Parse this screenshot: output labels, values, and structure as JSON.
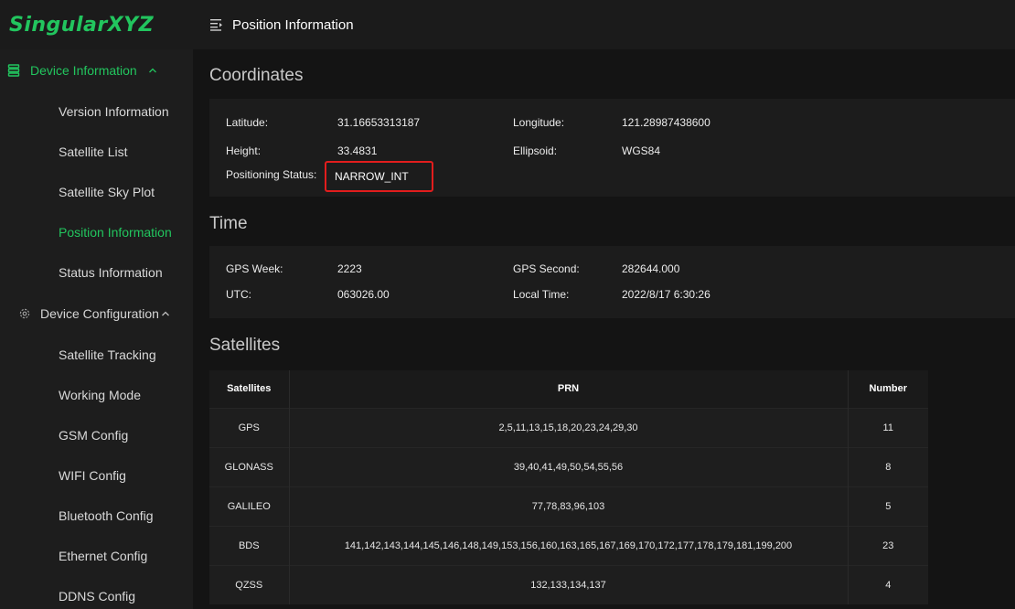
{
  "app": {
    "logo": "SingularXYZ"
  },
  "header": {
    "title": "Position Information"
  },
  "sidebar": {
    "groups": [
      {
        "label": "Device Information",
        "expanded": true
      },
      {
        "label": "Device Configuration",
        "expanded": true
      }
    ],
    "device_info_items": [
      {
        "label": "Version Information"
      },
      {
        "label": "Satellite List"
      },
      {
        "label": "Satellite Sky Plot"
      },
      {
        "label": "Position Information"
      },
      {
        "label": "Status Information"
      }
    ],
    "device_config_items": [
      {
        "label": "Satellite Tracking"
      },
      {
        "label": "Working Mode"
      },
      {
        "label": "GSM Config"
      },
      {
        "label": "WIFI Config"
      },
      {
        "label": "Bluetooth Config"
      },
      {
        "label": "Ethernet Config"
      },
      {
        "label": "DDNS Config"
      }
    ],
    "active_item": "Position Information"
  },
  "coordinates": {
    "title": "Coordinates",
    "latitude_label": "Latitude:",
    "latitude_value": "31.16653313187",
    "longitude_label": "Longitude:",
    "longitude_value": "121.28987438600",
    "height_label": "Height:",
    "height_value": "33.4831",
    "ellipsoid_label": "Ellipsoid:",
    "ellipsoid_value": "WGS84",
    "status_label": "Positioning Status:",
    "status_value": "NARROW_INT"
  },
  "time": {
    "title": "Time",
    "gps_week_label": "GPS Week:",
    "gps_week_value": "2223",
    "gps_second_label": "GPS Second:",
    "gps_second_value": "282644.000",
    "utc_label": "UTC:",
    "utc_value": "063026.00",
    "local_time_label": "Local Time:",
    "local_time_value": "2022/8/17 6:30:26"
  },
  "satellites": {
    "title": "Satellites",
    "headers": [
      "Satellites",
      "PRN",
      "Number"
    ],
    "rows": [
      [
        "GPS",
        "2,5,11,13,15,18,20,23,24,29,30",
        "11"
      ],
      [
        "GLONASS",
        "39,40,41,49,50,54,55,56",
        "8"
      ],
      [
        "GALILEO",
        "77,78,83,96,103",
        "5"
      ],
      [
        "BDS",
        "141,142,143,144,145,146,148,149,153,156,160,163,165,167,169,170,172,177,178,179,181,199,200",
        "23"
      ],
      [
        "QZSS",
        "132,133,134,137",
        "4"
      ]
    ]
  },
  "colors": {
    "accent": "#22c55e",
    "highlight_border": "#e21d1d",
    "background": "#141414"
  }
}
